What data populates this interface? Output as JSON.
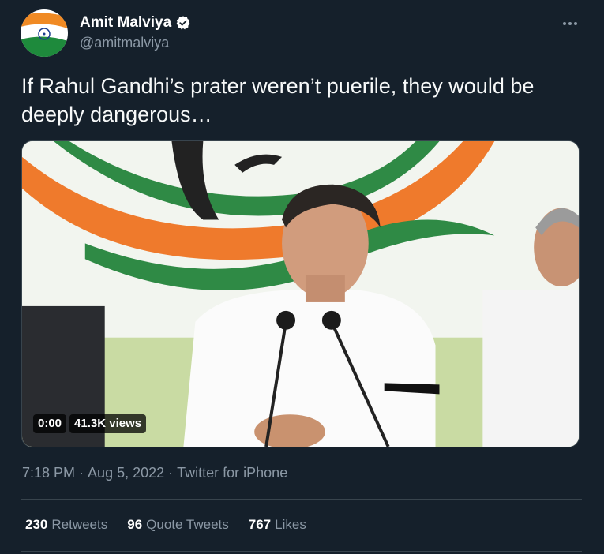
{
  "author": {
    "display_name": "Amit Malviya",
    "handle": "@amitmalviya",
    "avatar_icon": "india-flag-avatar",
    "verified_icon": "verified-badge-icon"
  },
  "tweet": {
    "text": "If Rahul Gandhi’s prater weren’t puerile, they would be deeply dangerous…"
  },
  "media": {
    "type": "video",
    "timestamp": "0:00",
    "views": "41.3K views"
  },
  "meta": {
    "time": "7:18 PM",
    "separator1": "·",
    "date": "Aug 5, 2022",
    "separator2": "·",
    "source": "Twitter for iPhone"
  },
  "stats": {
    "retweets_count": "230",
    "retweets_label": "Retweets",
    "quotes_count": "96",
    "quotes_label": "Quote Tweets",
    "likes_count": "767",
    "likes_label": "Likes"
  },
  "colors": {
    "background": "#15202b",
    "secondary_text": "#8b98a5",
    "verified": "#ffffff",
    "divider": "#38444d"
  }
}
